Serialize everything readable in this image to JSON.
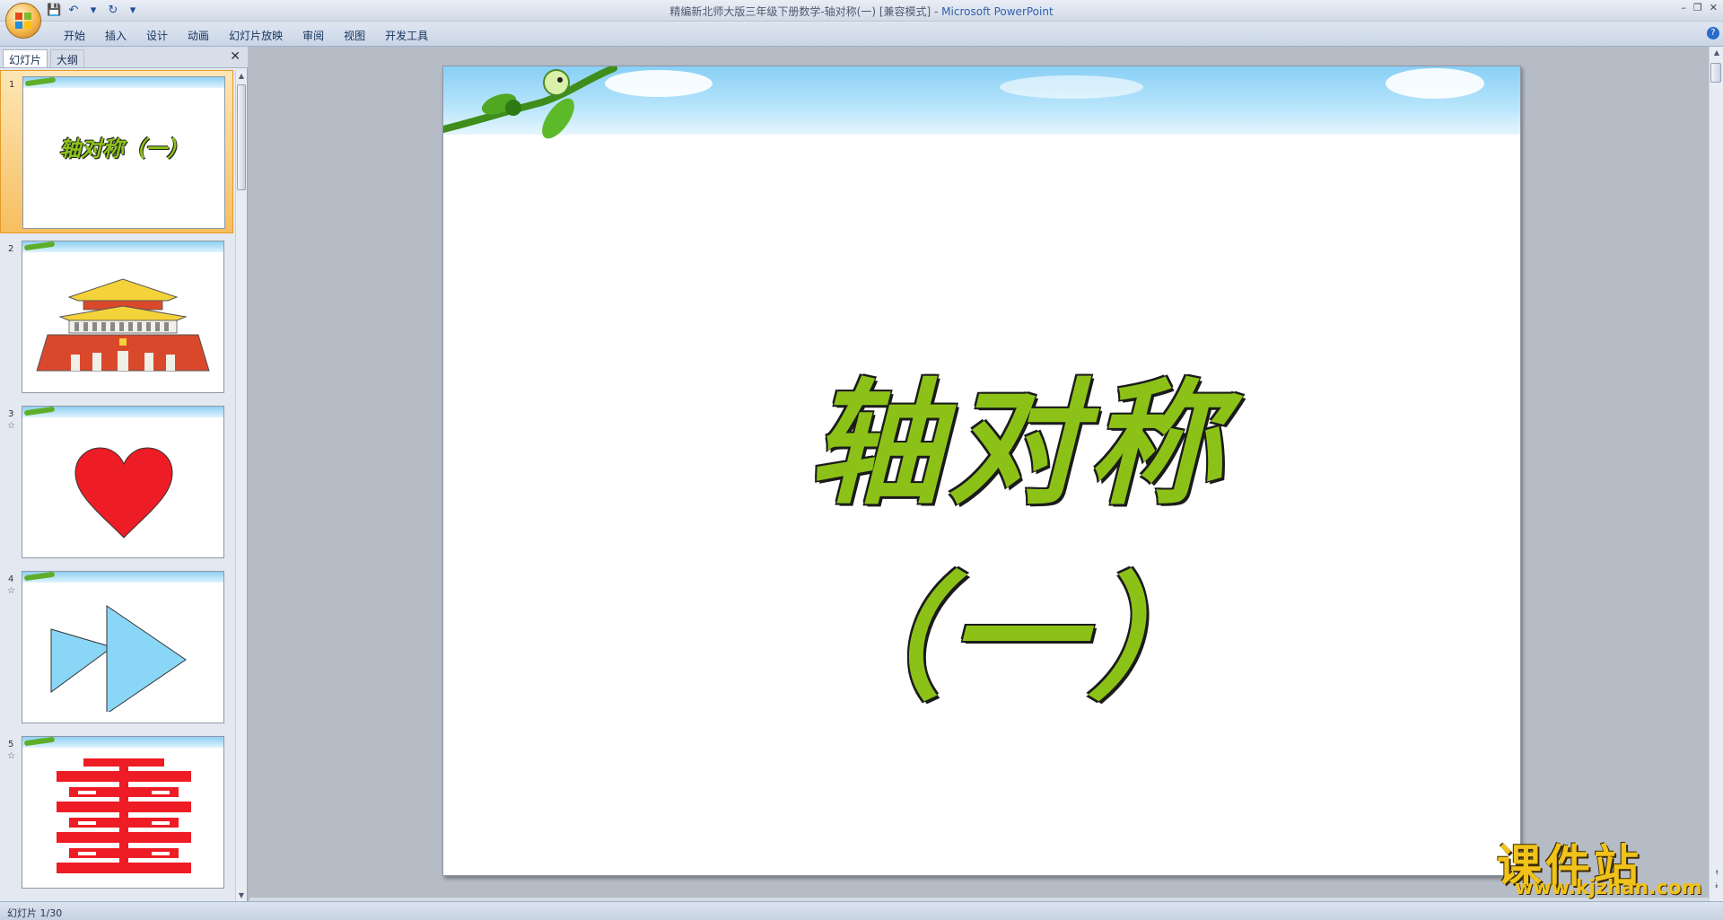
{
  "window": {
    "title": "精编新北师大版三年级下册数学-轴对称(一) [兼容模式] -",
    "app_name": "Microsoft PowerPoint",
    "controls": [
      "–",
      "❐",
      "✕"
    ]
  },
  "qat": {
    "items": [
      {
        "icon": "save-icon",
        "glyph": "💾"
      },
      {
        "icon": "undo-icon",
        "glyph": "↶"
      },
      {
        "icon": "dropdown-icon",
        "glyph": "▾"
      },
      {
        "icon": "redo-icon",
        "glyph": "↻"
      },
      {
        "icon": "customize-icon",
        "glyph": "▾"
      }
    ]
  },
  "ribbon": {
    "tabs": [
      "开始",
      "插入",
      "设计",
      "动画",
      "幻灯片放映",
      "审阅",
      "视图",
      "开发工具"
    ],
    "help": "?"
  },
  "left_pane": {
    "tab_slides": "幻灯片",
    "tab_outline": "大纲",
    "close": "✕",
    "thumbnails": [
      {
        "num": "1",
        "content": "title",
        "text": "轴对称（一）",
        "selected": true,
        "star": ""
      },
      {
        "num": "2",
        "content": "tiananmen",
        "selected": false,
        "star": ""
      },
      {
        "num": "3",
        "content": "heart",
        "selected": false,
        "star": "☆"
      },
      {
        "num": "4",
        "content": "arrows",
        "selected": false,
        "star": "☆"
      },
      {
        "num": "5",
        "content": "double-happiness",
        "selected": false,
        "star": "☆"
      }
    ]
  },
  "slide": {
    "title": "轴对称（一）"
  },
  "status": {
    "text": "幻灯片 1/30"
  },
  "watermark": {
    "cn": "课件站",
    "url": "www.kjzhan.com"
  },
  "colors": {
    "title_green": "#8cc218",
    "selection_orange": "#f6bf60",
    "heart_red": "#ee1c25",
    "arrow_blue": "#8ad6f7"
  }
}
